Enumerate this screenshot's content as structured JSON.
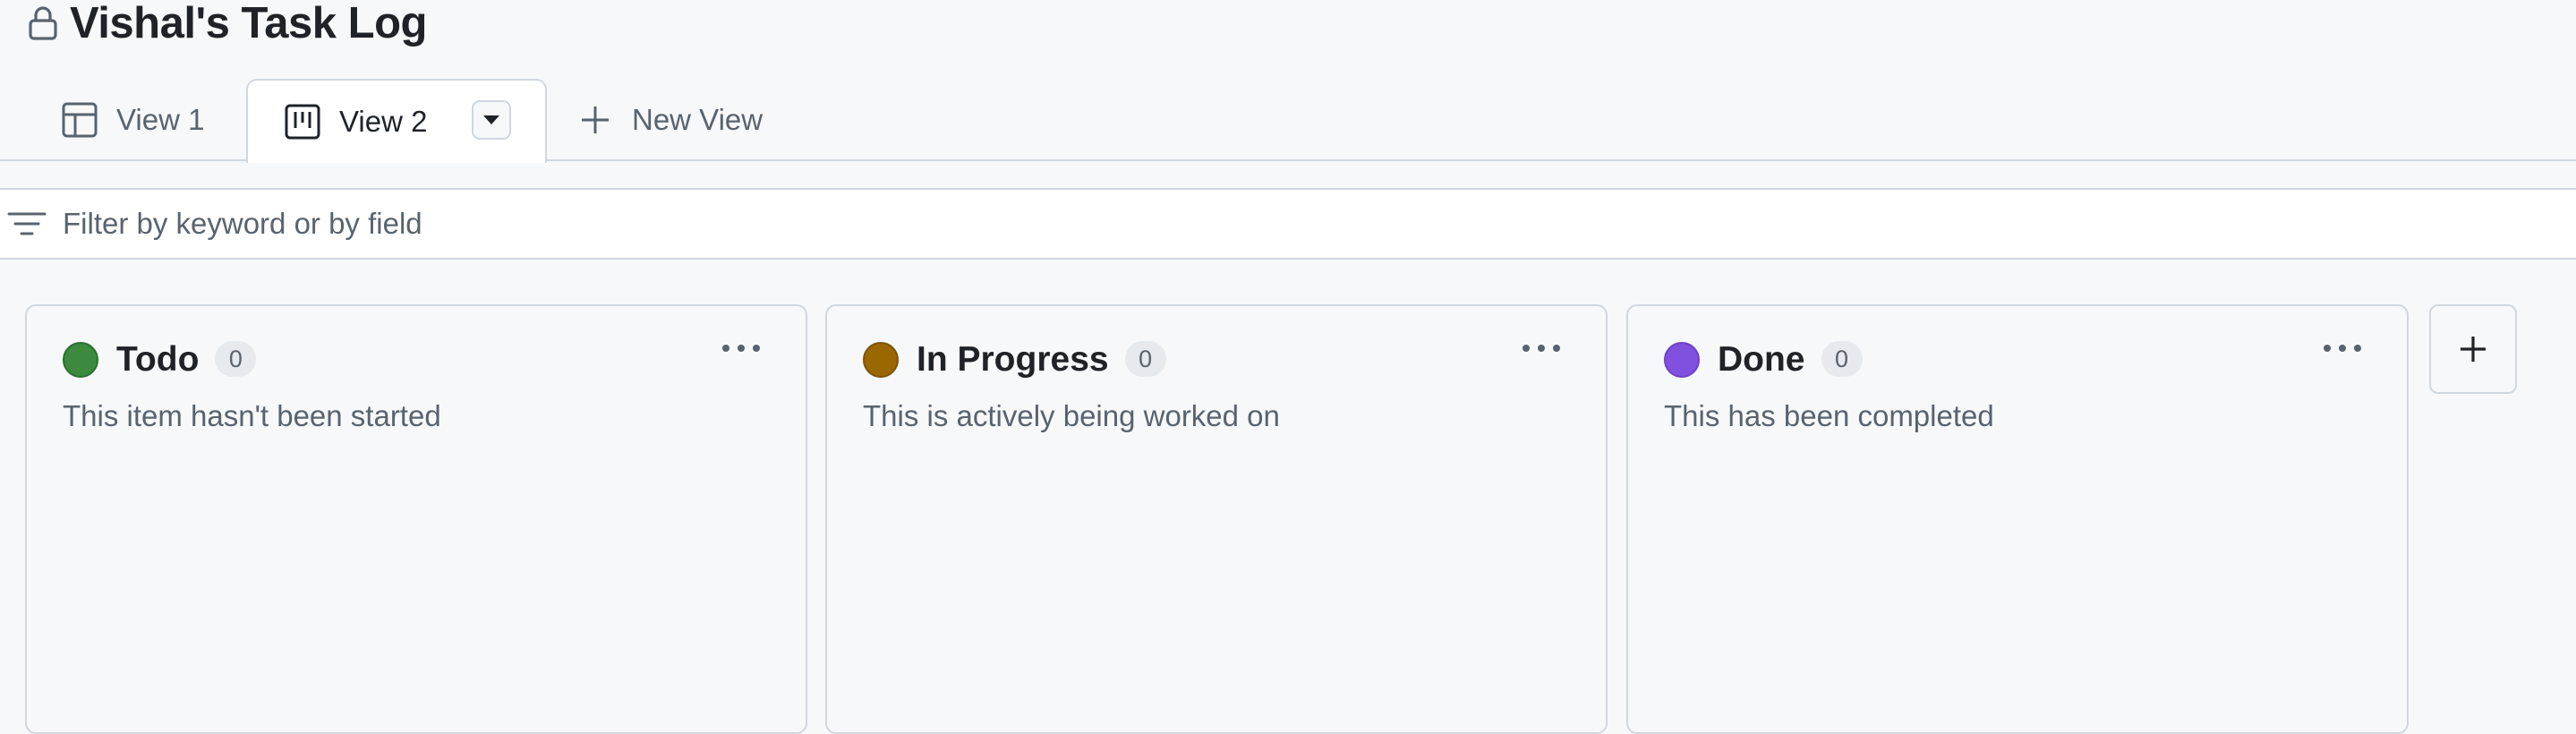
{
  "project": {
    "title": "Vishal's Task Log"
  },
  "tabs": [
    {
      "label": "View 1",
      "icon": "table-icon",
      "active": false
    },
    {
      "label": "View 2",
      "icon": "board-icon",
      "active": true
    },
    {
      "label": "New View",
      "icon": "plus-icon",
      "active": false
    }
  ],
  "filter": {
    "placeholder": "Filter by keyword or by field",
    "value": ""
  },
  "columns": [
    {
      "title": "Todo",
      "count": "0",
      "description": "This item hasn't been started",
      "color": "#3b8a3e",
      "border": "#2c6e30"
    },
    {
      "title": "In Progress",
      "count": "0",
      "description": "This is actively being worked on",
      "color": "#9a6700",
      "border": "#7d5400"
    },
    {
      "title": "Done",
      "count": "0",
      "description": "This has been completed",
      "color": "#8250df",
      "border": "#6e40c9"
    }
  ],
  "icons": {
    "lock": "lock-icon",
    "filter": "filter-icon",
    "column_menu": "kebab-horizontal-icon",
    "add_column": "plus-icon",
    "view_dropdown": "triangle-down-icon"
  }
}
